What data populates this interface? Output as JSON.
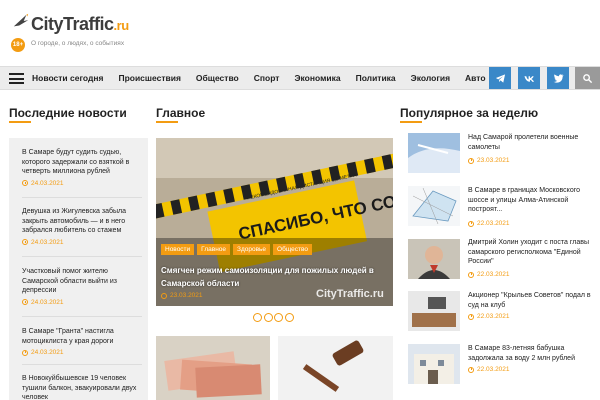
{
  "header": {
    "logo_text": "CityTraffic",
    "logo_domain": ".ru",
    "tagline": "О городе, о людях, о событиях",
    "age_badge": "18+"
  },
  "nav": {
    "items": [
      "Новости сегодня",
      "Происшествия",
      "Общество",
      "Спорт",
      "Экономика",
      "Политика",
      "Экология",
      "Авто"
    ],
    "social": [
      "telegram-icon",
      "vk-icon",
      "twitter-icon",
      "search-icon"
    ]
  },
  "sections": {
    "latest": "Последние новости",
    "main": "Главное",
    "popular": "Популярное за неделю"
  },
  "latest_news": [
    {
      "text": "В Самаре будут судить судью, которого задержали со взяткой в четверть миллиона рублей",
      "date": "24.03.2021"
    },
    {
      "text": "Девушка из Жигулевска забыла закрыть автомобиль — и в него забрался любитель со стажем",
      "date": "24.03.2021"
    },
    {
      "text": "Участковый помог жителю Самарской области выйти из депрессии",
      "date": "24.03.2021"
    },
    {
      "text": "В Самаре \"Гранта\" настигла мотоциклиста у края дороги",
      "date": "24.03.2021"
    },
    {
      "text": "В Новокуйбышевске 19 человек тушили балкон, эвакуировали двух человек",
      "date": ""
    }
  ],
  "feature": {
    "tags": [
      "Новости",
      "Главное",
      "Здоровье",
      "Общество"
    ],
    "title": "Смягчен режим самоизоляции для пожилых людей в Самарской области",
    "date": "23.03.2021",
    "watermark": "CityTraffic.ru",
    "sign_text": "СПАСИБО, ЧТО СОБЛЮДАЕТЕ",
    "sign_small": "РЕКОМЕНДОВАННАЯ ДИСТАНЦИЯ 1,5 МЕТРА"
  },
  "popular": [
    {
      "text": "Над Самарой пролетели военные самолеты",
      "date": "23.03.2021"
    },
    {
      "text": "В Самаре в границах Московского шоссе и улицы Алма-Атинской построят...",
      "date": "22.03.2021"
    },
    {
      "text": "Дмитрий Холин уходит с поста главы самарского регисполкома \"Единой России\"",
      "date": "22.03.2021"
    },
    {
      "text": "Акционер \"Крыльев Советов\" подал в суд на клуб",
      "date": "22.03.2021"
    },
    {
      "text": "В Самаре 83-летняя бабушка задолжала за воду 2 млн рублей",
      "date": "22.03.2021"
    }
  ],
  "colors": {
    "accent": "#f39c12",
    "social": "#3a88c8",
    "nav_bg": "#ececec"
  }
}
